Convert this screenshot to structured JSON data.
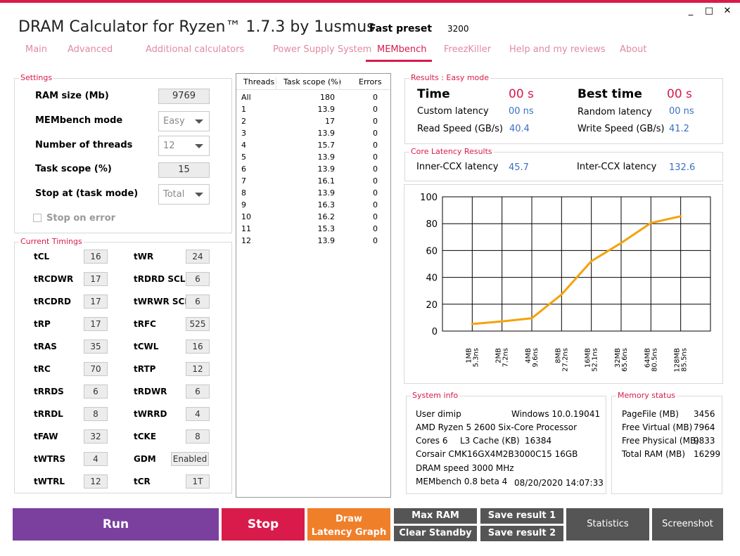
{
  "window": {
    "title": "DRAM Calculator for Ryzen™ 1.7.3 by 1usmus",
    "controls": [
      "_",
      "□",
      "✕"
    ],
    "preset_label": "Fast preset",
    "preset_value": "3200"
  },
  "tabs": [
    {
      "label": "Main"
    },
    {
      "label": "Advanced"
    },
    {
      "label": "Additional calculators"
    },
    {
      "label": "Power Supply System"
    },
    {
      "label": "MEMbench"
    },
    {
      "label": "FreezKiller"
    },
    {
      "label": "Help and my reviews"
    },
    {
      "label": "About"
    }
  ],
  "settings": {
    "title": "Settings",
    "ram_size_label": "RAM size (Mb)",
    "ram_size_value": "9769",
    "mode_label": "MEMbench mode",
    "mode_value": "Easy",
    "threads_label": "Number of threads",
    "threads_value": "12",
    "task_scope_label": "Task scope (%)",
    "task_scope_value": "15",
    "stop_at_label": "Stop at (task mode)",
    "stop_at_value": "Total",
    "stop_on_error_label": "Stop on error"
  },
  "timings": {
    "title": "Current Timings",
    "left": [
      {
        "label": "tCL",
        "value": "16"
      },
      {
        "label": "tRCDWR",
        "value": "17"
      },
      {
        "label": "tRCDRD",
        "value": "17"
      },
      {
        "label": "tRP",
        "value": "17"
      },
      {
        "label": "tRAS",
        "value": "35"
      },
      {
        "label": "tRC",
        "value": "70"
      },
      {
        "label": "tRRDS",
        "value": "6"
      },
      {
        "label": "tRRDL",
        "value": "8"
      },
      {
        "label": "tFAW",
        "value": "32"
      },
      {
        "label": "tWTRS",
        "value": "4"
      },
      {
        "label": "tWTRL",
        "value": "12"
      }
    ],
    "right": [
      {
        "label": "tWR",
        "value": "24"
      },
      {
        "label": "tRDRD SCL",
        "value": "6"
      },
      {
        "label": "tWRWR SCL",
        "value": "6"
      },
      {
        "label": "tRFC",
        "value": "525"
      },
      {
        "label": "tCWL",
        "value": "16"
      },
      {
        "label": "tRTP",
        "value": "12"
      },
      {
        "label": "tRDWR",
        "value": "6"
      },
      {
        "label": "tWRRD",
        "value": "4"
      },
      {
        "label": "tCKE",
        "value": "8"
      },
      {
        "label": "GDM",
        "value": "Enabled"
      },
      {
        "label": "tCR",
        "value": "1T"
      }
    ]
  },
  "threads_table": {
    "headers": [
      "Threads",
      "Task scope (%)",
      "Errors"
    ],
    "rows": [
      [
        "All",
        "180",
        "0"
      ],
      [
        "1",
        "13.9",
        "0"
      ],
      [
        "2",
        "17",
        "0"
      ],
      [
        "3",
        "13.9",
        "0"
      ],
      [
        "4",
        "15.7",
        "0"
      ],
      [
        "5",
        "13.9",
        "0"
      ],
      [
        "6",
        "13.9",
        "0"
      ],
      [
        "7",
        "16.1",
        "0"
      ],
      [
        "8",
        "13.9",
        "0"
      ],
      [
        "9",
        "16.3",
        "0"
      ],
      [
        "10",
        "16.2",
        "0"
      ],
      [
        "11",
        "15.3",
        "0"
      ],
      [
        "12",
        "13.9",
        "0"
      ]
    ]
  },
  "results": {
    "title": "Results : Easy mode",
    "time_label": "Time",
    "time_value": "00 s",
    "best_time_label": "Best time",
    "best_time_value": "00 s",
    "custom_latency_label": "Custom latency",
    "custom_latency_value": "00 ns",
    "random_latency_label": "Random latency",
    "random_latency_value": "00 ns",
    "read_speed_label": "Read Speed (GB/s)",
    "read_speed_value": "40.4",
    "write_speed_label": "Write Speed (GB/s)",
    "write_speed_value": "41.2"
  },
  "core_latency": {
    "title": "Core Latency Results",
    "inner_label": "Inner-CCX latency",
    "inner_value": "45.7",
    "inter_label": "Inter-CCX latency",
    "inter_value": "132.6"
  },
  "chart_data": {
    "type": "line",
    "categories": [
      "1MB",
      "2MB",
      "4MB",
      "8MB",
      "16MB",
      "32MB",
      "64MB",
      "128MB"
    ],
    "category_values": [
      "5.3ns",
      "7.2ns",
      "9.6ns",
      "27.2ns",
      "52.1ns",
      "65.6ns",
      "80.5ns",
      "85.5ns"
    ],
    "values": [
      5.3,
      7.2,
      9.6,
      27.2,
      52.1,
      65.6,
      80.5,
      85.5
    ],
    "ylim": [
      0,
      100
    ],
    "yticks": [
      "0",
      "20",
      "40",
      "60",
      "80",
      "100"
    ],
    "grid": true,
    "line_color": "#f5a20a"
  },
  "system_info": {
    "title": "System info",
    "user": "User dimip",
    "os": "Windows 10.0.19041",
    "cpu": "AMD Ryzen 5 2600 Six-Core Processor",
    "cores": "Cores 6",
    "l3_label": "L3 Cache (KB)",
    "l3_value": "16384",
    "memory": "Corsair CMK16GX4M2B3000C15  16GB",
    "dram_speed": "DRAM speed 3000 MHz",
    "membench": "MEMbench 0.8 beta 4",
    "datetime": "08/20/2020 14:07:33"
  },
  "memory_status": {
    "title": "Memory status",
    "rows": [
      {
        "label": "PageFile (MB)",
        "value": "3456"
      },
      {
        "label": "Free Virtual (MB)",
        "value": "7964"
      },
      {
        "label": "Free Physical (MB)",
        "value": "9833"
      },
      {
        "label": "Total RAM (MB)",
        "value": "16299"
      }
    ]
  },
  "buttons": {
    "run": "Run",
    "stop": "Stop",
    "draw_line1": "Draw",
    "draw_line2": "Latency Graph",
    "max_ram": "Max RAM",
    "clear_standby": "Clear Standby",
    "save1": "Save result 1",
    "save2": "Save result 2",
    "statistics": "Statistics",
    "screenshot": "Screenshot"
  },
  "colors": {
    "accent": "#d81b4a",
    "run": "#7b3f9e",
    "stop": "#d81b4a",
    "draw": "#f07f2a",
    "gray_button": "#555555",
    "value_blue": "#3a6fc4"
  }
}
